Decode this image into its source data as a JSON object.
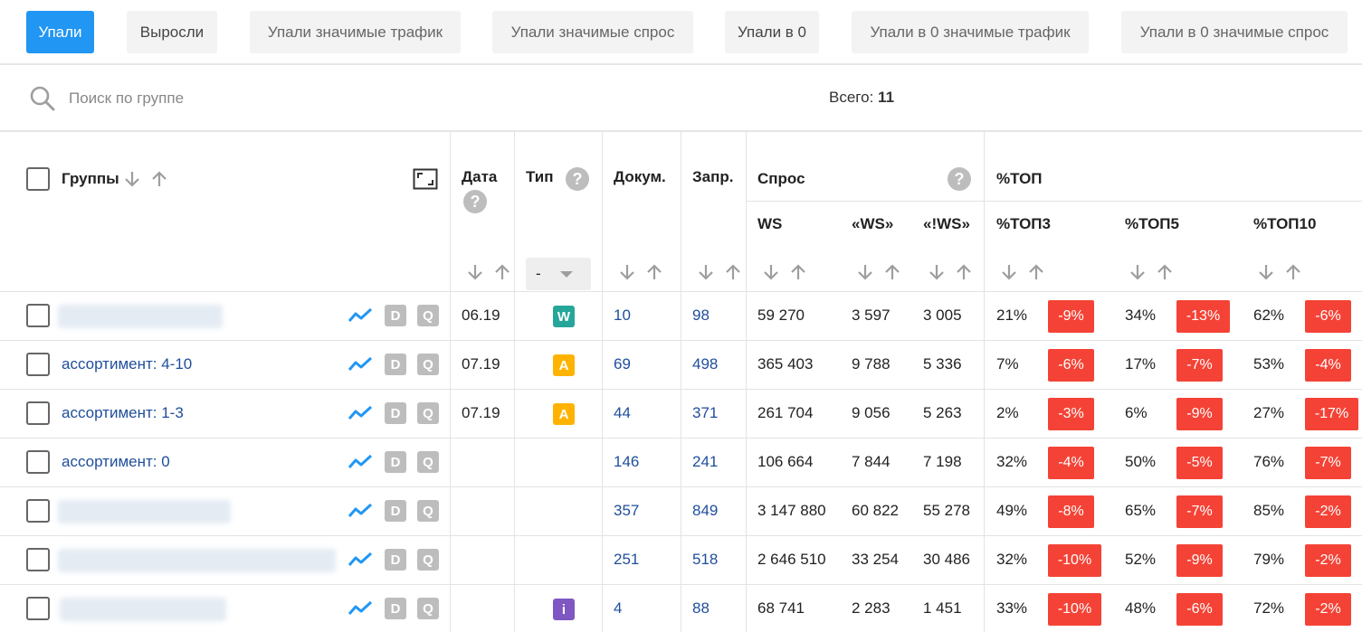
{
  "tabs": [
    {
      "label": "Упали",
      "active": true
    },
    {
      "label": "Выросли"
    },
    {
      "label": "Упали значимые трафик"
    },
    {
      "label": "Упали значимые спрос"
    },
    {
      "label": "Упали в 0"
    },
    {
      "label": "Упали в 0 значимые трафик"
    },
    {
      "label": "Упали в 0 значимые спрос"
    }
  ],
  "search": {
    "placeholder": "Поиск по группе"
  },
  "total": {
    "label": "Всего:",
    "value": "11"
  },
  "headers": {
    "groups": "Группы",
    "date": "Дата",
    "type": "Тип",
    "docs": "Докум.",
    "queries": "Запр.",
    "demand": "Спрос",
    "ws": "WS",
    "ws_quoted": "«WS»",
    "ws_exact": "«!WS»",
    "top": "%ТОП",
    "top3": "%ТОП3",
    "top5": "%ТОП5",
    "top10": "%ТОП10",
    "help_glyph": "?",
    "type_filter": "-"
  },
  "row_buttons": {
    "d": "D",
    "q": "Q"
  },
  "colors": {
    "accent": "#2196f3",
    "link": "#1f4e9c",
    "delta_negative": "#f44336",
    "badge_w": "#26a69a",
    "badge_a": "#ffb300",
    "badge_i": "#7e57c2"
  },
  "rows": [
    {
      "name": "",
      "blurred": true,
      "date": "06.19",
      "type": "W",
      "docs": "10",
      "queries": "98",
      "ws": "59 270",
      "wsq": "3 597",
      "wse": "3 005",
      "t3": "21%",
      "d3": "-9%",
      "t5": "34%",
      "d5": "-13%",
      "t10": "62%",
      "d10": "-6%"
    },
    {
      "name": "ассортимент: 4-10",
      "date": "07.19",
      "type": "A",
      "docs": "69",
      "queries": "498",
      "ws": "365 403",
      "wsq": "9 788",
      "wse": "5 336",
      "t3": "7%",
      "d3": "-6%",
      "t5": "17%",
      "d5": "-7%",
      "t10": "53%",
      "d10": "-4%"
    },
    {
      "name": "ассортимент: 1-3",
      "date": "07.19",
      "type": "A",
      "docs": "44",
      "queries": "371",
      "ws": "261 704",
      "wsq": "9 056",
      "wse": "5 263",
      "t3": "2%",
      "d3": "-3%",
      "t5": "6%",
      "d5": "-9%",
      "t10": "27%",
      "d10": "-17%"
    },
    {
      "name": "ассортимент: 0",
      "date": "",
      "type": "",
      "docs": "146",
      "queries": "241",
      "ws": "106 664",
      "wsq": "7 844",
      "wse": "7 198",
      "t3": "32%",
      "d3": "-4%",
      "t5": "50%",
      "d5": "-5%",
      "t10": "76%",
      "d10": "-7%"
    },
    {
      "name": "",
      "blurred": true,
      "date": "",
      "type": "",
      "docs": "357",
      "queries": "849",
      "ws": "3 147 880",
      "wsq": "60 822",
      "wse": "55 278",
      "t3": "49%",
      "d3": "-8%",
      "t5": "65%",
      "d5": "-7%",
      "t10": "85%",
      "d10": "-2%"
    },
    {
      "name": "",
      "blurred": true,
      "date": "",
      "type": "",
      "docs": "251",
      "queries": "518",
      "ws": "2 646 510",
      "wsq": "33 254",
      "wse": "30 486",
      "t3": "32%",
      "d3": "-10%",
      "t5": "52%",
      "d5": "-9%",
      "t10": "79%",
      "d10": "-2%"
    },
    {
      "name": "",
      "blurred": true,
      "date": "",
      "type": "i",
      "docs": "4",
      "queries": "88",
      "ws": "68 741",
      "wsq": "2 283",
      "wse": "1 451",
      "t3": "33%",
      "d3": "-10%",
      "t5": "48%",
      "d5": "-6%",
      "t10": "72%",
      "d10": "-2%"
    }
  ]
}
